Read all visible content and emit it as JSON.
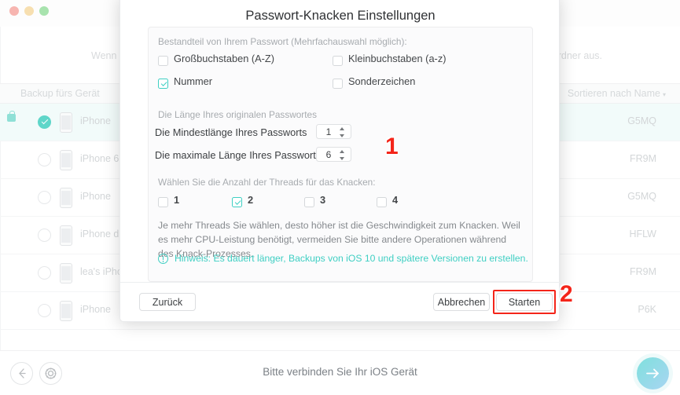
{
  "window": {
    "traffic_lights": [
      "close",
      "minimize",
      "maximize"
    ],
    "background_text_left": "Wenn Ihr Ba",
    "background_text_right": "Ordner aus.",
    "list_header_title": "Backup fürs Gerät",
    "sort_label": "Sortieren nach Name",
    "sort_caret": "▾",
    "devices": [
      {
        "name": "iPhone",
        "id": "G5MQ",
        "selected": true,
        "locked": true
      },
      {
        "name": "iPhone 6",
        "id": "FR9M",
        "selected": false,
        "locked": false
      },
      {
        "name": "iPhone",
        "id": "G5MQ",
        "selected": false,
        "locked": false
      },
      {
        "name": "iPhone d'iM",
        "id": "HFLW",
        "selected": false,
        "locked": false
      },
      {
        "name": "lea's iPhon",
        "id": "FR9M",
        "selected": false,
        "locked": false
      },
      {
        "name": "iPhone",
        "id": "P6K",
        "selected": false,
        "locked": false
      }
    ]
  },
  "bottom_bar": {
    "back_icon": "arrow-left-icon",
    "settings_icon": "gear-icon",
    "status_text": "Bitte verbinden Sie Ihr iOS Gerät",
    "next_icon": "arrow-right-icon"
  },
  "modal": {
    "title": "Passwort-Knacken Einstellungen",
    "component_section": {
      "label": "Bestandteil von Ihrem Passwort (Mehrfachauswahl möglich):",
      "options": [
        {
          "label": "Großbuchstaben (A-Z)",
          "checked": false
        },
        {
          "label": "Kleinbuchstaben (a-z)",
          "checked": false
        },
        {
          "label": "Nummer",
          "checked": true
        },
        {
          "label": "Sonderzeichen",
          "checked": false
        }
      ]
    },
    "length_section": {
      "label": "Die Länge Ihres originalen Passwortes",
      "min_label": "Die Mindestlänge Ihres Passworts",
      "min_value": "1",
      "max_label": "Die maximale Länge Ihres Passworts",
      "max_value": "6"
    },
    "threads_section": {
      "label": "Wählen Sie die Anzahl der Threads für das Knacken:",
      "options": [
        {
          "label": "1",
          "checked": false
        },
        {
          "label": "2",
          "checked": true
        },
        {
          "label": "3",
          "checked": false
        },
        {
          "label": "4",
          "checked": false
        }
      ],
      "description": "Je mehr Threads Sie wählen, desto höher ist die Geschwindigkeit zum Knacken. Weil es mehr CPU-Leistung benötigt, vermeiden Sie bitte andere Operationen während des Knack-Prozesses."
    },
    "hint": {
      "icon": "info-circle-icon",
      "text": "Hinweis: Es dauert länger, Backups von iOS 10 und spätere Versionen zu erstellen."
    },
    "footer": {
      "back_label": "Zurück",
      "cancel_label": "Abbrechen",
      "start_label": "Starten"
    }
  },
  "annotations": [
    {
      "number": "1"
    },
    {
      "number": "2"
    }
  ],
  "colors": {
    "accent_teal": "#3fcfc3",
    "annotation_red": "#f4251a",
    "selected_row": "#f2fbfa"
  }
}
